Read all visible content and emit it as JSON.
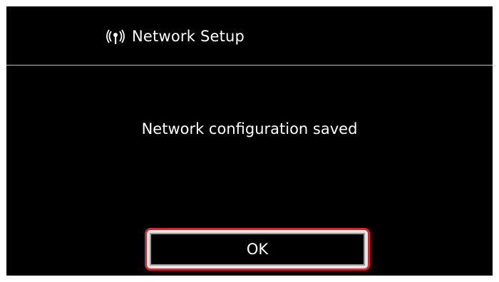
{
  "header": {
    "icon": "wireless-icon",
    "title": "Network Setup"
  },
  "dialog": {
    "message": "Network configuration saved",
    "ok_label": "OK"
  },
  "colors": {
    "screen_background": "#000000",
    "text": "#ffffff",
    "highlight_frame": "#e3202a"
  }
}
